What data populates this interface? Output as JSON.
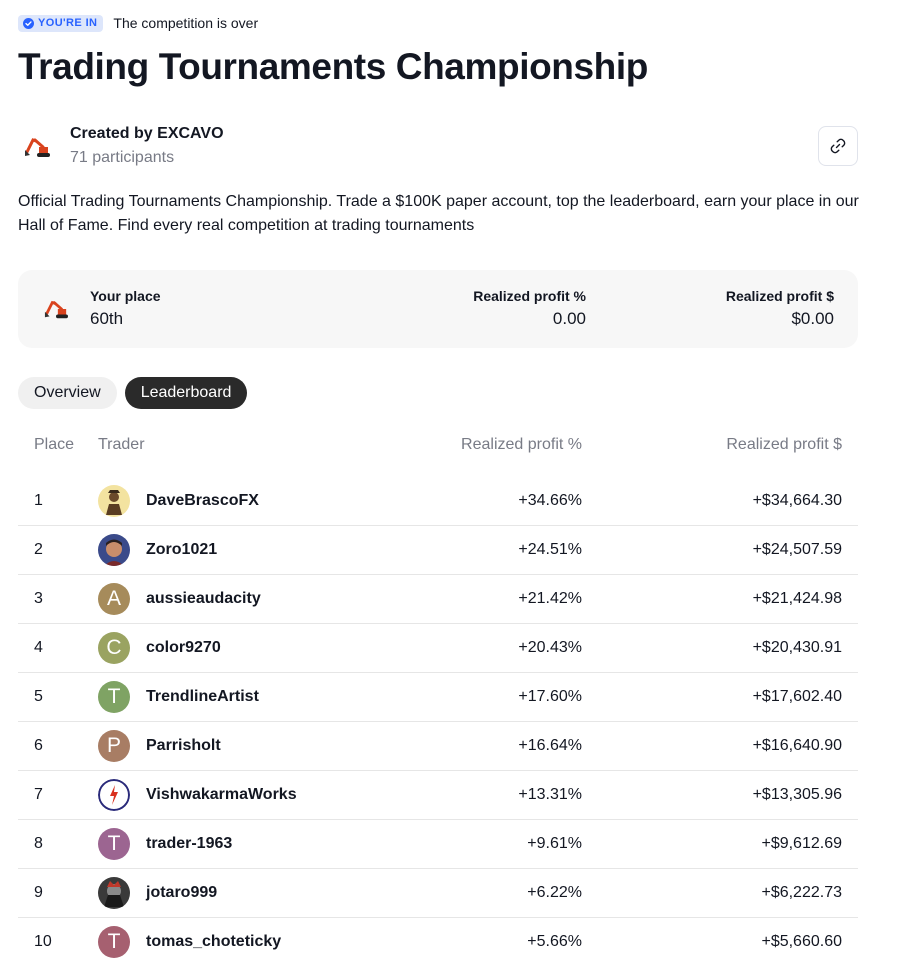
{
  "status": {
    "badge_label": "YOU'RE IN",
    "text": "The competition is over"
  },
  "title": "Trading Tournaments Championship",
  "creator": {
    "name": "Created by EXCAVO",
    "participants": "71 participants",
    "logo_icon": "excavator-icon"
  },
  "description": "Official Trading Tournaments Championship. Trade a $100K paper account, top the leaderboard, earn your place in our Hall of Fame. Find every real competition at trading tournaments",
  "stats": {
    "place_label": "Your place",
    "place_value": "60th",
    "pct_label": "Realized profit %",
    "pct_value": "0.00",
    "usd_label": "Realized profit $",
    "usd_value": "$0.00"
  },
  "tabs": [
    {
      "label": "Overview",
      "active": false
    },
    {
      "label": "Leaderboard",
      "active": true
    }
  ],
  "table": {
    "headers": {
      "place": "Place",
      "trader": "Trader",
      "pct": "Realized profit %",
      "usd": "Realized profit $"
    },
    "rows": [
      {
        "place": "1",
        "name": "DaveBrascoFX",
        "pct": "+34.66%",
        "usd": "+$34,664.30",
        "avatar": {
          "type": "photo",
          "icon": "photo-avatar-icon",
          "color": "#f3e3a0"
        }
      },
      {
        "place": "2",
        "name": "Zoro1021",
        "pct": "+24.51%",
        "usd": "+$24,507.59",
        "avatar": {
          "type": "photo",
          "icon": "photo-avatar-icon",
          "color": "#3a4a8a"
        }
      },
      {
        "place": "3",
        "name": "aussieaudacity",
        "pct": "+21.42%",
        "usd": "+$21,424.98",
        "avatar": {
          "type": "letter",
          "letter": "A",
          "color": "#a68b5b"
        }
      },
      {
        "place": "4",
        "name": "color9270",
        "pct": "+20.43%",
        "usd": "+$20,430.91",
        "avatar": {
          "type": "letter",
          "letter": "C",
          "color": "#9aa361"
        }
      },
      {
        "place": "5",
        "name": "TrendlineArtist",
        "pct": "+17.60%",
        "usd": "+$17,602.40",
        "avatar": {
          "type": "letter",
          "letter": "T",
          "color": "#7fa364"
        }
      },
      {
        "place": "6",
        "name": "Parrisholt",
        "pct": "+16.64%",
        "usd": "+$16,640.90",
        "avatar": {
          "type": "letter",
          "letter": "P",
          "color": "#a87d64"
        }
      },
      {
        "place": "7",
        "name": "VishwakarmaWorks",
        "pct": "+13.31%",
        "usd": "+$13,305.96",
        "avatar": {
          "type": "photo",
          "icon": "logo-avatar-icon",
          "color": "#ffffff"
        }
      },
      {
        "place": "8",
        "name": "trader-1963",
        "pct": "+9.61%",
        "usd": "+$9,612.69",
        "avatar": {
          "type": "letter",
          "letter": "T",
          "color": "#9c6591"
        }
      },
      {
        "place": "9",
        "name": "jotaro999",
        "pct": "+6.22%",
        "usd": "+$6,222.73",
        "avatar": {
          "type": "photo",
          "icon": "photo-avatar-icon",
          "color": "#3a3a3a"
        }
      },
      {
        "place": "10",
        "name": "tomas_choteticky",
        "pct": "+5.66%",
        "usd": "+$5,660.60",
        "avatar": {
          "type": "letter",
          "letter": "T",
          "color": "#a66070"
        }
      }
    ]
  },
  "colors": {
    "accent": "#2962ff",
    "badge_bg": "#dde6fb",
    "muted_text": "#787b86",
    "active_tab": "#2a2a2a"
  }
}
